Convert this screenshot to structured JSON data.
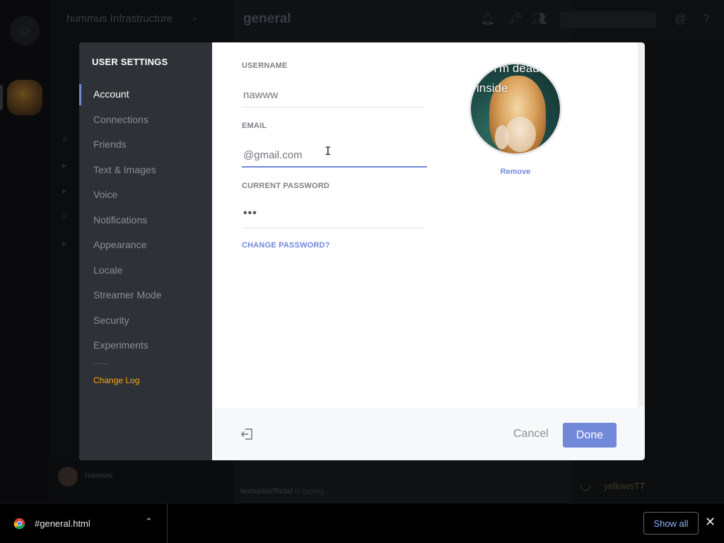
{
  "background": {
    "server_name": "hummus Infrastructure",
    "channel_title": "general",
    "current_user": "nawww",
    "typing_user": "testuisiofficial",
    "typing_text": "is typing...",
    "member_visible": "yellowsTT"
  },
  "settings": {
    "title": "USER SETTINGS",
    "nav": [
      {
        "label": "Account",
        "active": true
      },
      {
        "label": "Connections"
      },
      {
        "label": "Friends"
      },
      {
        "label": "Text & Images"
      },
      {
        "label": "Voice"
      },
      {
        "label": "Notifications"
      },
      {
        "label": "Appearance"
      },
      {
        "label": "Locale"
      },
      {
        "label": "Streamer Mode"
      },
      {
        "label": "Security"
      },
      {
        "label": "Experiments"
      }
    ],
    "changelog_label": "Change Log",
    "fields": {
      "username_label": "USERNAME",
      "username_value": "nawww",
      "email_label": "EMAIL",
      "email_value": "@gmail.com",
      "password_label": "CURRENT PASSWORD",
      "password_value": "•••"
    },
    "change_password_label": "CHANGE PASSWORD?",
    "avatar": {
      "caption_line1": "I'm dead",
      "caption_line2": "inside",
      "remove_label": "Remove"
    },
    "footer": {
      "cancel_label": "Cancel",
      "done_label": "Done"
    },
    "colors": {
      "accent": "#7289da",
      "sidebar": "#2e3136",
      "changelog": "#faa61a"
    }
  },
  "download_shelf": {
    "file_name": "#general.html",
    "show_all_label": "Show all"
  }
}
